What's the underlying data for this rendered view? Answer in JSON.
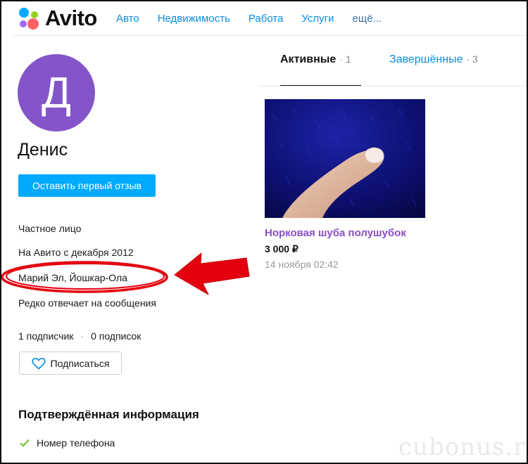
{
  "header": {
    "logo_text": "Avito",
    "nav": [
      {
        "label": "Авто"
      },
      {
        "label": "Недвижимость"
      },
      {
        "label": "Работа"
      },
      {
        "label": "Услуги"
      },
      {
        "label": "ещё..."
      }
    ]
  },
  "profile": {
    "avatar_letter": "Д",
    "avatar_color": "#8455c8",
    "name": "Денис",
    "review_button": "Оставить первый отзыв",
    "type": "Частное лицо",
    "since": "На Авито с декабря 2012",
    "location": "Марий Эл, Йошкар-Ола",
    "response": "Редко отвечает на сообщения",
    "subscribers": "1 подписчик",
    "subscriptions": "0 подписок",
    "subscribe_button": "Подписаться",
    "verified_title": "Подтверждённая информация",
    "verified_items": [
      {
        "label": "Номер телефона",
        "icon": "check-icon"
      }
    ]
  },
  "tabs": [
    {
      "label": "Активные",
      "count": "1"
    },
    {
      "label": "Завершённые",
      "count": "3"
    }
  ],
  "listing": {
    "title": "Норковая шуба полушубок",
    "price": "3 000 ₽",
    "date": "14 ноября 02:42"
  },
  "colors": {
    "accent": "#00aaff",
    "link": "#0b8ee0",
    "listing_title": "#8a4fc4",
    "annotation": "#e3000f"
  },
  "watermark": "cubonus.ru"
}
